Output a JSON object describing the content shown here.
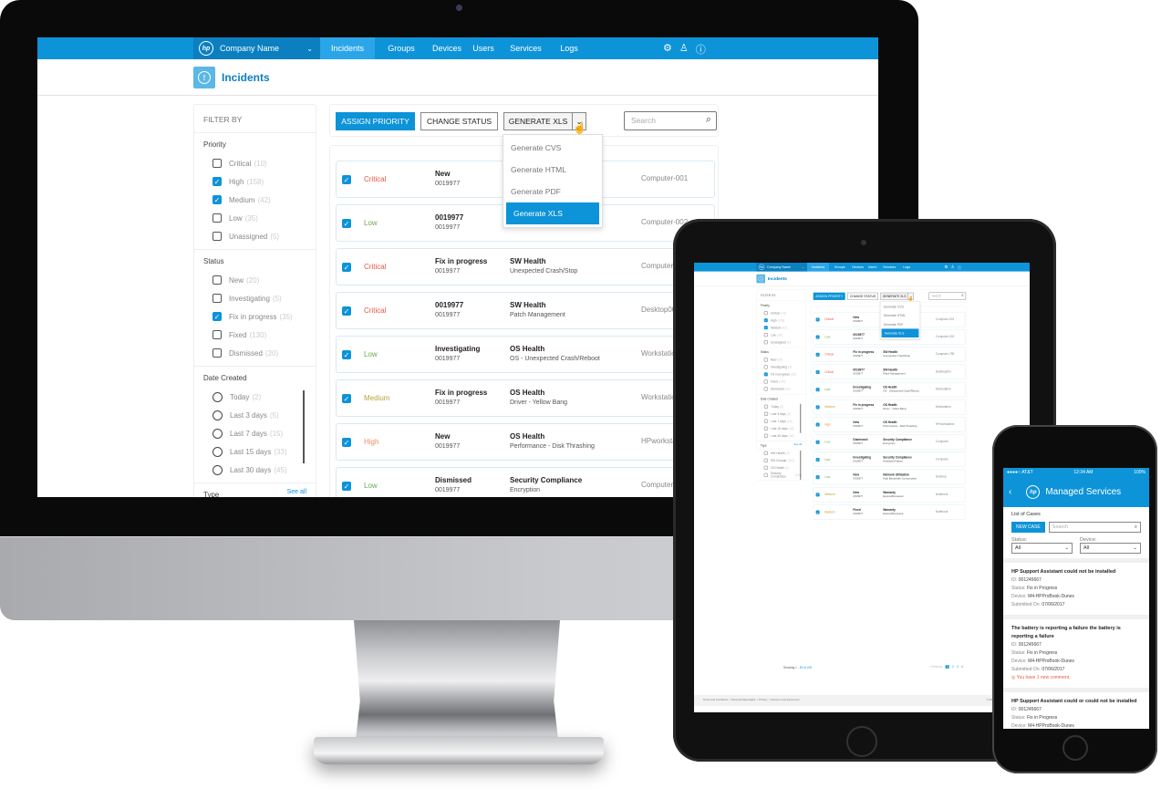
{
  "app": {
    "brand": "Company Name",
    "logo": "hp",
    "nav_tabs": [
      "Incidents",
      "Groups",
      "Devices",
      "Users",
      "Services",
      "Logs"
    ],
    "active_tab": "Incidents",
    "nav_icons": [
      "gear-icon",
      "user-icon",
      "help-icon"
    ],
    "page_title": "Incidents",
    "filter": {
      "title": "FILTER BY",
      "priority": {
        "label": "Priority",
        "items": [
          {
            "label": "Critical",
            "count": "(10)",
            "checked": false
          },
          {
            "label": "High",
            "count": "(158)",
            "checked": true
          },
          {
            "label": "Medium",
            "count": "(42)",
            "checked": true
          },
          {
            "label": "Low",
            "count": "(35)",
            "checked": false
          },
          {
            "label": "Unassigned",
            "count": "(5)",
            "checked": false
          }
        ]
      },
      "status": {
        "label": "Status",
        "items": [
          {
            "label": "New",
            "count": "(20)",
            "checked": false
          },
          {
            "label": "Investigating",
            "count": "(5)",
            "checked": false
          },
          {
            "label": "Fix in progress",
            "count": "(35)",
            "checked": true
          },
          {
            "label": "Fixed",
            "count": "(130)",
            "checked": false
          },
          {
            "label": "Dismissed",
            "count": "(20)",
            "checked": false
          }
        ]
      },
      "date": {
        "label": "Date Created",
        "items": [
          {
            "label": "Today",
            "count": "(2)"
          },
          {
            "label": "Last 3 days",
            "count": "(5)"
          },
          {
            "label": "Last 7 days",
            "count": "(15)"
          },
          {
            "label": "Last 15 days",
            "count": "(33)"
          },
          {
            "label": "Last 30 days",
            "count": "(45)"
          }
        ]
      },
      "type": {
        "label": "Type",
        "see_all": "See all",
        "items": [
          {
            "label": "HW Health",
            "count": "(2)"
          },
          {
            "label": "SW Change",
            "count": "(224)"
          },
          {
            "label": "OS Health",
            "count": "(2)"
          },
          {
            "label": "Security Compliance",
            "count": "(224)"
          }
        ]
      }
    },
    "toolbar": {
      "assign_priority": "ASSIGN PRIORITY",
      "change_status": "CHANGE STATUS",
      "generate": "GENERATE XLS",
      "search_placeholder": "Search"
    },
    "generate_menu": [
      "Generate CVS",
      "Generate HTML",
      "Generate PDF",
      "Generate XLS"
    ],
    "generate_selected": "Generate XLS",
    "priority_colors": {
      "Critical": "#e8574a",
      "High": "#f08a5d",
      "Medium": "#b9a43a",
      "Low": "#6aaa4f"
    },
    "incidents": [
      {
        "priority": "Critical",
        "status": "New",
        "id": "0019977",
        "category": "",
        "subcategory": "",
        "device": "Computer-001"
      },
      {
        "priority": "Low",
        "status": "0019977",
        "id": "0019977",
        "category": "",
        "subcategory": "",
        "device": "Computer-002"
      },
      {
        "priority": "Critical",
        "status": "Fix in progress",
        "id": "0019977",
        "category": "SW Health",
        "subcategory": "Unexpected Crash/Stop",
        "device": "Computer-789"
      },
      {
        "priority": "Critical",
        "status": "0019977",
        "id": "0019977",
        "category": "SW Health",
        "subcategory": "Patch Management",
        "device": "Desktop001"
      },
      {
        "priority": "Low",
        "status": "Investigating",
        "id": "0019977",
        "category": "OS Health",
        "subcategory": "OS - Unexpected Crash/Reboot",
        "device": "Workstation"
      },
      {
        "priority": "Medium",
        "status": "Fix in progress",
        "id": "0019977",
        "category": "OS Health",
        "subcategory": "Driver - Yellow Bang",
        "device": "Workstation"
      },
      {
        "priority": "High",
        "status": "New",
        "id": "0019977",
        "category": "OS Health",
        "subcategory": "Performance - Disk Thrashing",
        "device": "HPworkstation"
      },
      {
        "priority": "Low",
        "status": "Dismissed",
        "id": "0019977",
        "category": "Security Compliance",
        "subcategory": "Encryption",
        "device": "Computer"
      },
      {
        "priority": "Low",
        "status": "Investigating",
        "id": "0019977",
        "category": "Security Compliance",
        "subcategory": "Heartbeat Failure",
        "device": "Computer"
      },
      {
        "priority": "Low",
        "status": "New",
        "id": "0019977",
        "category": "Network Utilization",
        "subcategory": "High Bandwidth Consumption",
        "device": "Desktop"
      },
      {
        "priority": "Medium",
        "status": "New",
        "id": "0019977",
        "category": "Warranty",
        "subcategory": "Expired/Renewed",
        "device": "Notebook"
      },
      {
        "priority": "Medium",
        "status": "Fixed",
        "id": "0019977",
        "category": "Warranty",
        "subcategory": "Expired/Renewed",
        "device": "Notebook"
      }
    ],
    "pagination": {
      "showing_prefix": "Showing",
      "range": "1 - 50 of 200",
      "previous": "‹ Previous",
      "pages": [
        "1",
        "2",
        "3",
        "4"
      ],
      "current": "1"
    },
    "footer": {
      "links": [
        "Terms and Conditions",
        "Personal Data Rights",
        "Privacy",
        "Service Level Agreement"
      ],
      "copyright": "© 2017 HP Development Com"
    }
  },
  "mobile": {
    "status_bar": {
      "carrier": "●●●●○ AT&T",
      "time": "12:34 AM",
      "battery": "100%"
    },
    "title": "Managed Services",
    "list_title": "List of Cases",
    "new_case": "NEW CASE",
    "search_placeholder": "Search",
    "status_label": "Status:",
    "status_value": "All",
    "device_label": "Device:",
    "device_value": "All",
    "field_labels": {
      "id": "ID:",
      "status": "Status:",
      "device": "Device:",
      "submitted": "Submitted On:"
    },
    "cases": [
      {
        "title": "HP Support Assistant could not be installed",
        "id": "001245667",
        "status": "Fix in Progress",
        "device": "M4-HPProBook-Dunes",
        "submitted": "07/06/2017",
        "comment": ""
      },
      {
        "title": "The battery is reporting a failure the battery is reporting a failure",
        "id": "001245667",
        "status": "Fix in Progress",
        "device": "M4-HPProBook-Dunes",
        "submitted": "07/06/2017",
        "comment": "You have 1 new comment."
      },
      {
        "title": "HP Support Assistant could or could not be installed",
        "id": "001245667",
        "status": "Fix in Progress",
        "device": "M4-HPProBook-Dunes",
        "submitted": "",
        "comment": ""
      }
    ]
  }
}
